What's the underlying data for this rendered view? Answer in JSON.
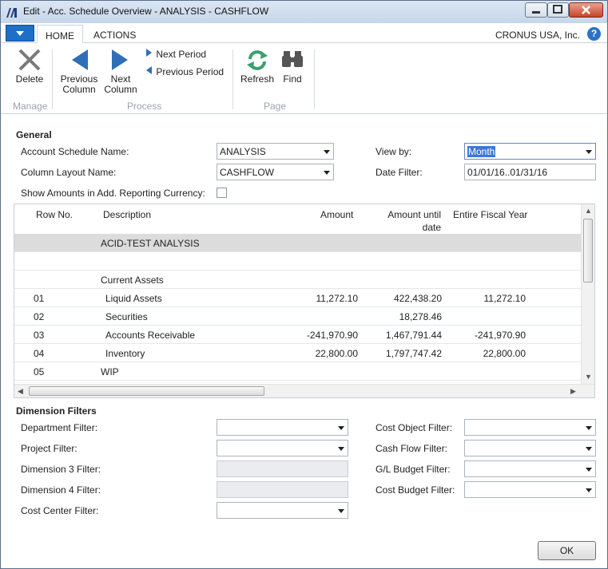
{
  "window": {
    "title": "Edit - Acc. Schedule Overview - ANALYSIS - CASHFLOW"
  },
  "tabs": {
    "home": "HOME",
    "actions": "ACTIONS"
  },
  "company": "CRONUS USA, Inc.",
  "help": "?",
  "ribbon": {
    "manage": {
      "label": "Manage",
      "delete": "Delete"
    },
    "process": {
      "label": "Process",
      "prev_col_1": "Previous",
      "prev_col_2": "Column",
      "next_col_1": "Next",
      "next_col_2": "Column",
      "next_period": "Next Period",
      "prev_period": "Previous Period"
    },
    "page": {
      "label": "Page",
      "refresh": "Refresh",
      "find": "Find"
    }
  },
  "general": {
    "title": "General",
    "acc_sched_label": "Account Schedule Name:",
    "acc_sched_value": "ANALYSIS",
    "col_layout_label": "Column Layout Name:",
    "col_layout_value": "CASHFLOW",
    "show_amounts_label": "Show Amounts in Add. Reporting Currency:",
    "view_by_label": "View by:",
    "view_by_value": "Month",
    "date_filter_label": "Date Filter:",
    "date_filter_value": "01/01/16..01/31/16"
  },
  "grid": {
    "headers": {
      "row_no": "Row No.",
      "description": "Description",
      "amount": "Amount",
      "amount_until_1": "Amount until",
      "amount_until_2": "date",
      "fiscal": "Entire Fiscal Year"
    },
    "rows": [
      {
        "row_no": "",
        "description": "ACID-TEST ANALYSIS",
        "amount": "",
        "until": "",
        "fiscal": ""
      },
      {
        "row_no": "",
        "description": "",
        "amount": "",
        "until": "",
        "fiscal": ""
      },
      {
        "row_no": "",
        "description": "Current Assets",
        "amount": "",
        "until": "",
        "fiscal": ""
      },
      {
        "row_no": "01",
        "description": "Liquid Assets",
        "amount": "11,272.10",
        "until": "422,438.20",
        "fiscal": "11,272.10"
      },
      {
        "row_no": "02",
        "description": "Securities",
        "amount": "",
        "until": "18,278.46",
        "fiscal": ""
      },
      {
        "row_no": "03",
        "description": "Accounts Receivable",
        "amount": "-241,970.90",
        "until": "1,467,791.44",
        "fiscal": "-241,970.90"
      },
      {
        "row_no": "04",
        "description": "Inventory",
        "amount": "22,800.00",
        "until": "1,797,747.42",
        "fiscal": "22,800.00"
      },
      {
        "row_no": "05",
        "description": "WIP",
        "amount": "",
        "until": "",
        "fiscal": ""
      }
    ]
  },
  "dimensions": {
    "title": "Dimension Filters",
    "department": "Department Filter:",
    "project": "Project Filter:",
    "dim3": "Dimension 3 Filter:",
    "dim4": "Dimension 4 Filter:",
    "cost_center": "Cost Center Filter:",
    "cost_object": "Cost Object Filter:",
    "cash_flow": "Cash Flow Filter:",
    "gl_budget": "G/L Budget Filter:",
    "cost_budget": "Cost Budget Filter:"
  },
  "ok": "OK",
  "colors": {
    "accent": "#1d6fc7",
    "ribbon_icon": "#2f6fb9",
    "refresh": "#3aa06b"
  }
}
